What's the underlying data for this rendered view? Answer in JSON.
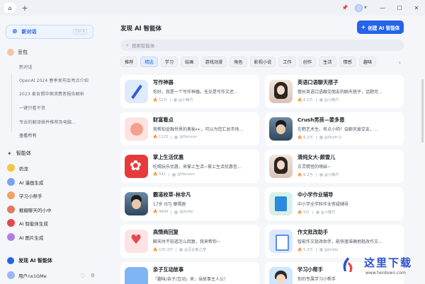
{
  "titlebar": {
    "home_icon": "home-icon",
    "new_tab_icon": "plus-icon",
    "pin_icon": "pin-icon",
    "minimize": "—",
    "maximize": "☐",
    "close": "✕"
  },
  "sidebar": {
    "new_chat_label": "新对话",
    "new_chat_shortcut": "Ctrl K",
    "bot_name": "豆包",
    "history": [
      "新对话",
      "OpenAI 2024 春季发布会亮点介绍",
      "2023 麦肯锡中国消费者报告解析",
      "一键只看干货",
      "专业的翻译插件推荐及电脑..."
    ],
    "view_all": "查看所有",
    "agents_heading": "智能体",
    "agents": [
      {
        "name": "奶龙",
        "color": "#f6c343"
      },
      {
        "name": "AI 漫画生成",
        "color": "#7aa2f7"
      },
      {
        "name": "学习小帮手",
        "color": "#f4a261"
      },
      {
        "name": "靓靓聊天的小中",
        "color": "#e07a5f"
      },
      {
        "name": "AI 智能体生成",
        "color": "#e5484d"
      },
      {
        "name": "AI 图片生成",
        "color": "#b07fe0"
      }
    ],
    "discover_label": "发现 AI 智能体",
    "user_name": "用户nx1GMe"
  },
  "main": {
    "title": "发现 AI 智能体",
    "create_button": "创建 AI 智能体",
    "search_placeholder": "搜索智能体",
    "categories": [
      "推荐",
      "精选",
      "学习",
      "绘画",
      "游戏动漫",
      "角色",
      "影视小说",
      "工作",
      "创作",
      "生活",
      "情感",
      "趣味"
    ],
    "active_category": "精选",
    "cards": [
      {
        "name": "写作神器",
        "desc": "你好，我是一个写作神器。无论是写作文还...",
        "uses": "52万",
        "author": "@小微尺",
        "thumb": "pen"
      },
      {
        "name": "英语口语聊天搭子",
        "desc": "擅长英语口语跟交朋友的聊天搭子，话题可...",
        "uses": "6.5万",
        "author": "@小微尺",
        "thumb": "person-f"
      },
      {
        "name": "财富看点",
        "desc": "我帮知金融世界的奥秘👀，可以为您汇总市场...",
        "uses": "1123",
        "author": "@Hanson",
        "thumb": "fortune"
      },
      {
        "name": "Crush男孩—姜多恩",
        "desc": "在鹤艺术生，有点小帅！会聊天爱交友，...",
        "uses": "6.2万",
        "author": "@Sheft Q",
        "thumb": "person-m"
      },
      {
        "name": "掌上生活优惠",
        "desc": "吃喝玩乐优惠，来掌上生活~掌上生活优惠信...",
        "uses": "541",
        "author": "@Hanson",
        "thumb": "flower"
      },
      {
        "name": "清纯女大-颜雪儿",
        "desc": "古灵精怪的萌妹~",
        "uses": "6.2万",
        "author": "@小微尺",
        "thumb": "person-f"
      },
      {
        "name": "霸道校草-林非凡",
        "desc": "17岁 ISTJ 摩羯座",
        "uses": "4694",
        "author": "@jimfei",
        "thumb": "person-m"
      },
      {
        "name": "中小学作业辅导",
        "desc": "中小学全学科作业答疑辅导",
        "uses": "5万",
        "author": "@小微尺",
        "thumb": "homework"
      },
      {
        "name": "高情商回复",
        "desc": "聊天时不知道怎么回复，我来帮你~",
        "uses": "105.3万",
        "author": "@豆比新之梦",
        "thumb": "heart"
      },
      {
        "name": "作文批改助手",
        "desc": "智能作文批改助手，能快速准确地批改作文...",
        "uses": "5.3万",
        "author": "@jimfei",
        "thumb": "grade"
      },
      {
        "name": "亲子互动故事",
        "desc": "「趣味/亲子/互动」来，当故事主人公！",
        "uses": "",
        "author": "",
        "thumb": "parent"
      },
      {
        "name": "学习小帮手",
        "desc": "你的专属学习小帮手",
        "uses": "",
        "author": "",
        "thumb": "study"
      }
    ]
  },
  "watermark": {
    "text": "这里下载",
    "url": "www.herdown.com"
  }
}
